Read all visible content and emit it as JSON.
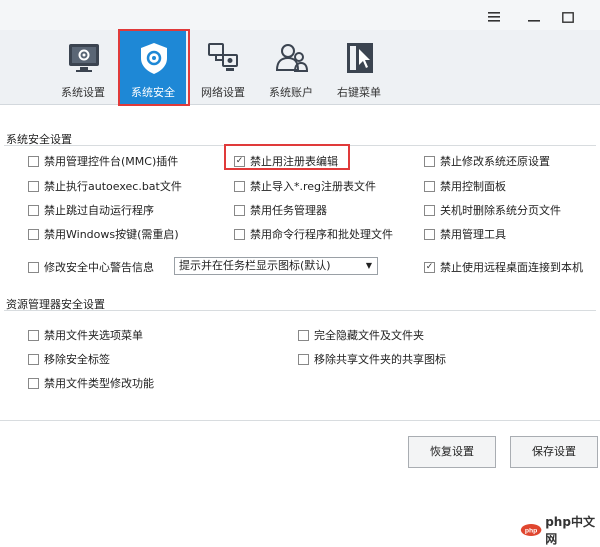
{
  "window": {
    "menu_icon": "menu-icon",
    "minimize_icon": "minimize-icon",
    "maximize_icon": "maximize-icon"
  },
  "toolbar": {
    "items": [
      {
        "label": "系统设置",
        "icon": "monitor-gear-icon"
      },
      {
        "label": "系统安全",
        "icon": "shield-gear-icon",
        "active": true
      },
      {
        "label": "网络设置",
        "icon": "network-icon"
      },
      {
        "label": "系统账户",
        "icon": "users-icon"
      },
      {
        "label": "右键菜单",
        "icon": "cursor-menu-icon"
      }
    ],
    "active_color": "#1e88d6"
  },
  "system_security": {
    "title": "系统安全设置",
    "checks": [
      {
        "label": "禁用管理控件台(MMC)插件",
        "checked": false
      },
      {
        "label": "禁止用注册表编辑",
        "checked": true
      },
      {
        "label": "禁止修改系统还原设置",
        "checked": false
      },
      {
        "label": "禁止执行autoexec.bat文件",
        "checked": false
      },
      {
        "label": "禁止导入*.reg注册表文件",
        "checked": false
      },
      {
        "label": "禁用控制面板",
        "checked": false
      },
      {
        "label": "禁止跳过自动运行程序",
        "checked": false
      },
      {
        "label": "禁用任务管理器",
        "checked": false
      },
      {
        "label": "关机时删除系统分页文件",
        "checked": false
      },
      {
        "label": "禁用Windows按键(需重启)",
        "checked": false
      },
      {
        "label": "禁用命令行程序和批处理文件",
        "checked": false
      },
      {
        "label": "禁用管理工具",
        "checked": false
      },
      {
        "label": "修改安全中心警告信息",
        "checked": false
      },
      {
        "label": "禁止使用远程桌面连接到本机",
        "checked": true
      }
    ],
    "dropdown_value": "提示并在任务栏显示图标(默认)"
  },
  "explorer_security": {
    "title": "资源管理器安全设置",
    "checks": [
      {
        "label": "禁用文件夹选项菜单",
        "checked": false
      },
      {
        "label": "完全隐藏文件及文件夹",
        "checked": false
      },
      {
        "label": "移除安全标签",
        "checked": false
      },
      {
        "label": "移除共享文件夹的共享图标",
        "checked": false
      },
      {
        "label": "禁用文件类型修改功能",
        "checked": false
      }
    ]
  },
  "actions": {
    "restore_label": "恢复设置",
    "save_label": "保存设置"
  },
  "watermark": {
    "text": "php中文网",
    "icon": "php-logo-icon"
  },
  "highlight_color": "#e03a3a",
  "check_mark": "✓"
}
